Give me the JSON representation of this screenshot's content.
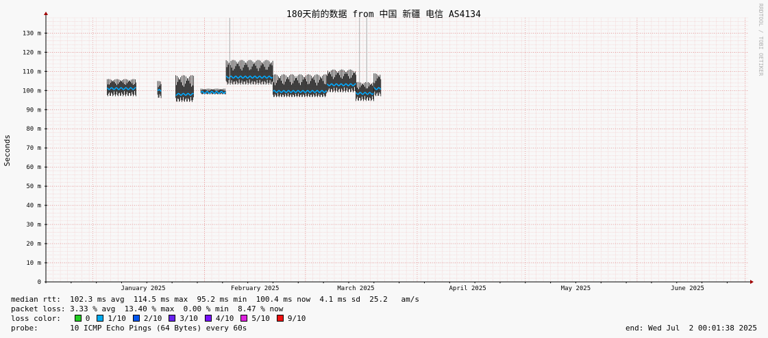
{
  "watermark": "RRDTOOL / TOBI OETIKER",
  "chart_data": {
    "type": "line",
    "title": "180天前的数据 from 中国 新疆 电信 AS4134",
    "xlabel": "",
    "ylabel": "Seconds",
    "ylim": [
      0,
      138
    ],
    "y_ticks": [
      {
        "v": 0,
        "label": "0"
      },
      {
        "v": 10,
        "label": "10 m"
      },
      {
        "v": 20,
        "label": "20 m"
      },
      {
        "v": 30,
        "label": "30 m"
      },
      {
        "v": 40,
        "label": "40 m"
      },
      {
        "v": 50,
        "label": "50 m"
      },
      {
        "v": 60,
        "label": "60 m"
      },
      {
        "v": 70,
        "label": "70 m"
      },
      {
        "v": 80,
        "label": "80 m"
      },
      {
        "v": 90,
        "label": "90 m"
      },
      {
        "v": 100,
        "label": "100 m"
      },
      {
        "v": 110,
        "label": "110 m"
      },
      {
        "v": 120,
        "label": "120 m"
      },
      {
        "v": 130,
        "label": "130 m"
      }
    ],
    "x_range": [
      "2024-12-19",
      "2025-07-02"
    ],
    "x_ticks": [
      {
        "date": "2025-01-15",
        "label": "January 2025"
      },
      {
        "date": "2025-02-15",
        "label": "February 2025"
      },
      {
        "date": "2025-03-15",
        "label": "March 2025"
      },
      {
        "date": "2025-04-15",
        "label": "April 2025"
      },
      {
        "date": "2025-05-15",
        "label": "May 2025"
      },
      {
        "date": "2025-06-15",
        "label": "June 2025"
      }
    ],
    "month_starts": [
      "2025-01-01",
      "2025-02-01",
      "2025-03-01",
      "2025-04-01",
      "2025-05-01",
      "2025-06-01",
      "2025-07-01"
    ],
    "segments": [
      {
        "start": "2025-01-05",
        "end": "2025-01-13",
        "median": 101,
        "spread": 5,
        "spike": 4
      },
      {
        "start": "2025-01-19",
        "end": "2025-01-20",
        "median": 100,
        "spread": 5,
        "spike": 4
      },
      {
        "start": "2025-01-24",
        "end": "2025-01-29",
        "median": 98,
        "spread": 10,
        "spike": 4
      },
      {
        "start": "2025-01-31",
        "end": "2025-02-07",
        "median": 99,
        "spread": 2,
        "spike": 1
      },
      {
        "start": "2025-02-07",
        "end": "2025-02-20",
        "median": 107,
        "spread": 9,
        "spike": 4
      },
      {
        "start": "2025-02-20",
        "end": "2025-03-07",
        "median": 99.5,
        "spread": 9,
        "spike": 3
      },
      {
        "start": "2025-03-07",
        "end": "2025-03-15",
        "median": 103,
        "spread": 8,
        "spike": 4
      },
      {
        "start": "2025-03-15",
        "end": "2025-03-20",
        "median": 98.5,
        "spread": 6,
        "spike": 4
      },
      {
        "start": "2025-03-20",
        "end": "2025-03-22",
        "median": 101,
        "spread": 8,
        "spike": 4
      }
    ],
    "max_spikes": [
      {
        "date": "2025-02-08",
        "value": 138
      },
      {
        "date": "2025-03-16",
        "value": 138
      },
      {
        "date": "2025-03-18",
        "value": 138
      }
    ],
    "colors": {
      "background": "#f8f8f8",
      "grid_minor": "#f2c8c8",
      "grid_major": "#e08a8a",
      "axis": "#000000",
      "arrow": "#a00000",
      "smoke": "#111111",
      "median": "#00aaff"
    }
  },
  "stats": {
    "median_rtt_label": "median rtt:",
    "median_rtt_values": "102.3 ms avg  114.5 ms max  95.2 ms min  100.4 ms now  4.1 ms sd  25.2   am/s",
    "packet_loss_label": "packet loss:",
    "packet_loss_values": "3.33 % avg  13.40 % max  0.00 % min  8.47 % now",
    "loss_color_label": "loss color:",
    "loss_colors": [
      {
        "label": "0",
        "color": "#22cc22"
      },
      {
        "label": "1/10",
        "color": "#00aaee"
      },
      {
        "label": "2/10",
        "color": "#0055ee"
      },
      {
        "label": "3/10",
        "color": "#6622ee"
      },
      {
        "label": "4/10",
        "color": "#7711ff"
      },
      {
        "label": "5/10",
        "color": "#dd22dd"
      },
      {
        "label": "9/10",
        "color": "#ee1111"
      }
    ],
    "probe_label": "probe:",
    "probe_value": "10 ICMP Echo Pings (64 Bytes) every 60s",
    "end_text": "end: Wed Jul  2 00:01:38 2025"
  }
}
